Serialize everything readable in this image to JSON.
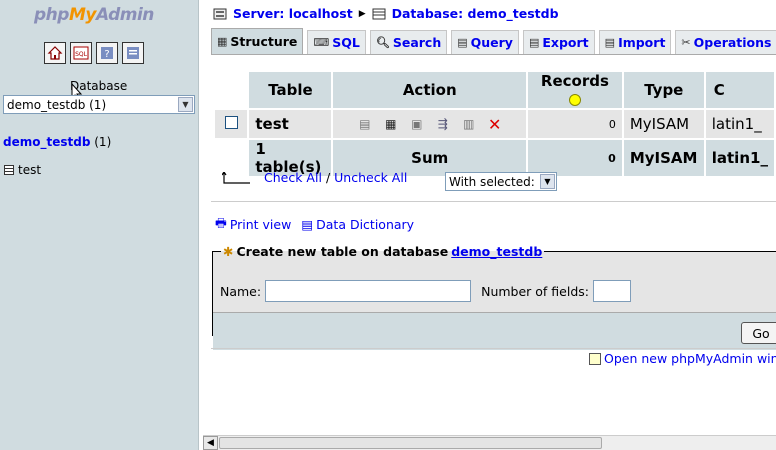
{
  "left": {
    "logo": {
      "php": "php",
      "my": "My",
      "admin": "Admin"
    },
    "icons": [
      "home-icon",
      "sql-query-icon",
      "docs-icon",
      "help-icon"
    ],
    "database_label": "Database",
    "database_select_value": "demo_testdb (1)",
    "database_link": "demo_testdb",
    "database_count": "(1)",
    "tables": [
      "test"
    ]
  },
  "right": {
    "serverbar": {
      "server": "Server: localhost",
      "database": "Database: demo_testdb"
    },
    "tabs": [
      "Structure",
      "SQL",
      "Search",
      "Query",
      "Export",
      "Import",
      "Operations"
    ],
    "active_tab": "Structure",
    "table_headers": [
      "Table",
      "Action",
      "Records",
      "Type",
      "C"
    ],
    "rows": [
      {
        "name": "test",
        "records": "0",
        "type": "MyISAM",
        "collation": "latin1_"
      }
    ],
    "summary": {
      "tables": "1 table(s)",
      "sum": "Sum",
      "records": "0",
      "type": "MyISAM",
      "collation": "latin1_"
    },
    "check_all": "Check All",
    "separator": "/",
    "uncheck_all": "Uncheck All",
    "with_selected": "With selected:",
    "print_view": "Print view",
    "data_dictionary": "Data Dictionary",
    "create_legend": "Create new table on database",
    "create_legend_db": "demo_testdb",
    "name_label": "Name:",
    "fields_label": "Number of fields:",
    "go": "Go",
    "new_window": "Open new phpMyAdmin wind"
  },
  "colors": {
    "accent": "#d0dce0",
    "row": "#e5e5e5",
    "link": "#0000ee",
    "logo_orange": "#f29400"
  }
}
